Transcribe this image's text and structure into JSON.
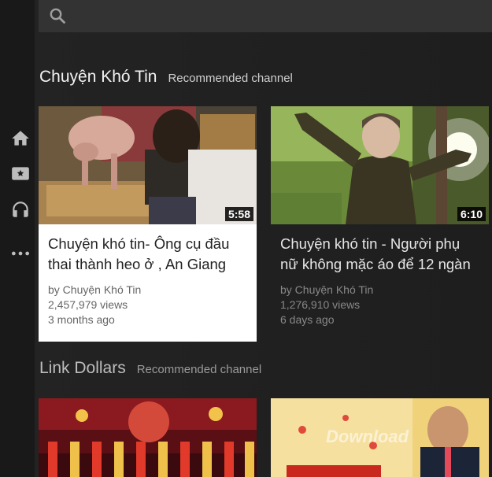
{
  "search": {
    "placeholder": "",
    "value": ""
  },
  "sidebar": {
    "items": [
      {
        "name": "home",
        "icon": "home-icon"
      },
      {
        "name": "subscriptions",
        "icon": "star-box-icon"
      },
      {
        "name": "music",
        "icon": "headphones-icon"
      },
      {
        "name": "more",
        "icon": "more-dots-icon"
      }
    ]
  },
  "sections": [
    {
      "title": "Chuyện Khó Tin",
      "subtitle": "Recommended channel",
      "videos": [
        {
          "title": "Chuyện khó tin- Ông cụ đầu thai thành heo ở , An Giang",
          "channel": "by Chuyện Khó Tin",
          "views": "2,457,979 views",
          "age": "3 months ago",
          "duration": "5:58",
          "selected": true
        },
        {
          "title": "Chuyện khó tin - Người phụ nữ không mặc áo để 12 ngàn",
          "channel": "by Chuyện Khó Tin",
          "views": "1,276,910 views",
          "age": "6 days ago",
          "duration": "6:10",
          "selected": false
        }
      ]
    },
    {
      "title": "Link Dollars",
      "subtitle": "Recommended channel",
      "videos": []
    }
  ],
  "watermark": "Download",
  "colors": {
    "background": "#1e1e1e",
    "search_bar": "#333333",
    "selected_card": "#ffffff",
    "icon": "#bdbdbd"
  }
}
